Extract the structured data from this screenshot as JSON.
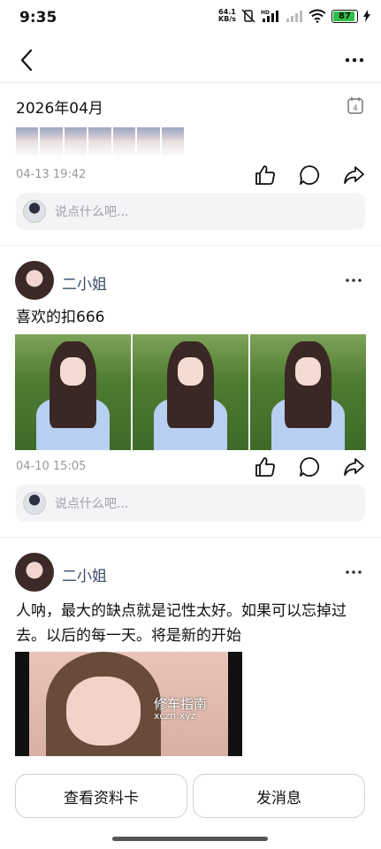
{
  "status_bar": {
    "time": "9:35",
    "net_speed_value": "64.1",
    "net_speed_unit": "KB/s",
    "hd_label": "HD",
    "battery_level": "87",
    "battery_color": "#2dbf45"
  },
  "nav": {
    "back_icon": "chevron-left-icon",
    "more_icon": "more-horizontal-icon"
  },
  "month_header": {
    "label": "2026年04月",
    "calendar_day": "4"
  },
  "posts": [
    {
      "time": "04-13 19:42",
      "comment_placeholder": "说点什么吧..."
    },
    {
      "author": "二小姐",
      "text": "喜欢的扣666",
      "photo_count": 3,
      "time": "04-10 15:05",
      "comment_placeholder": "说点什么吧..."
    },
    {
      "author": "二小姐",
      "text": "人呐，最大的缺点就是记性太好。如果可以忘掉过去。以后的每一天。将是新的开始",
      "video_watermark": "修车指南",
      "video_watermark_sub": "xczn.xyz"
    }
  ],
  "bottom": {
    "profile_card_label": "查看资料卡",
    "message_label": "发消息"
  },
  "colors": {
    "author_name": "#3b4a6a",
    "meta_text": "#999999",
    "comment_bg": "#f4f4f6"
  }
}
